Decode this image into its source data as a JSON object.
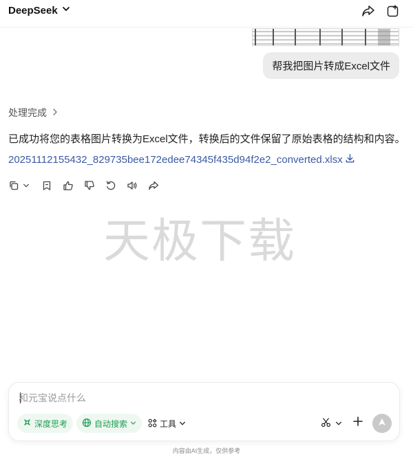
{
  "header": {
    "model_name": "DeepSeek"
  },
  "user_message": {
    "text": "帮我把图片转成Excel文件"
  },
  "assistant": {
    "process_label": "处理完成",
    "reply_text": "已成功将您的表格图片转换为Excel文件，转换后的文件保留了原始表格的结构和内容。",
    "file_name": "20251112155432_829735bee172edee74345f435d94f2e2_converted.xlsx",
    "actions": [
      "copy-icon",
      "chevron-down-icon",
      "bookmark-icon",
      "thumbs-up-icon",
      "thumbs-down-icon",
      "regenerate-icon",
      "speaker-icon",
      "share-icon"
    ]
  },
  "watermark": {
    "text": "天极下载"
  },
  "composer": {
    "placeholder": "和元宝说点什么",
    "deep_think_label": "深度思考",
    "auto_search_label": "自动搜索",
    "tools_label": "工具"
  },
  "footer": {
    "note": "内容由AI生成，仅供参考"
  },
  "colors": {
    "accent_green": "#1f9d55",
    "link_blue": "#3a5aa6",
    "bubble_bg": "#ececec"
  }
}
